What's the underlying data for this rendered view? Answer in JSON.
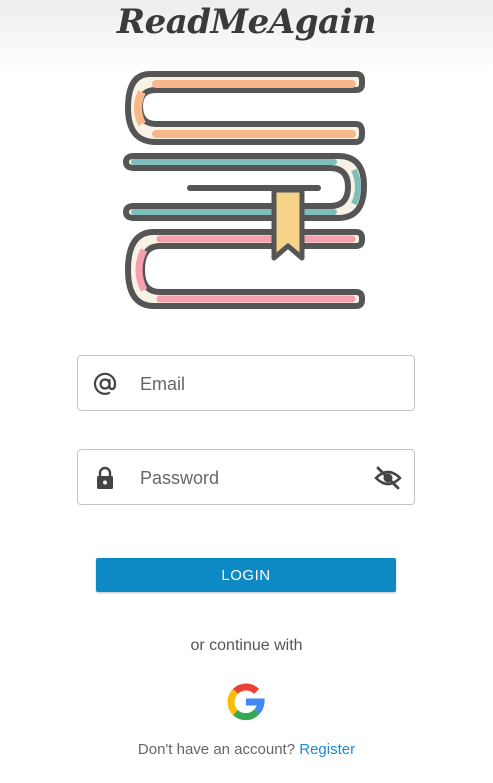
{
  "app": {
    "title": "ReadMeAgain"
  },
  "icons": {
    "logo": "books-stack-icon",
    "email": "at-sign-icon",
    "password": "lock-icon",
    "visibility": "eye-off-icon",
    "google": "google-icon"
  },
  "form": {
    "email": {
      "placeholder": "Email",
      "value": ""
    },
    "password": {
      "placeholder": "Password",
      "value": ""
    }
  },
  "login": {
    "label": "LOGIN"
  },
  "alt": {
    "text": "or continue with"
  },
  "footer": {
    "prompt": "Don't have an account?",
    "link": "Register"
  },
  "colors": {
    "primary": "#0d89c4",
    "link": "#1e8ad6",
    "text": "#3a3a3a"
  }
}
